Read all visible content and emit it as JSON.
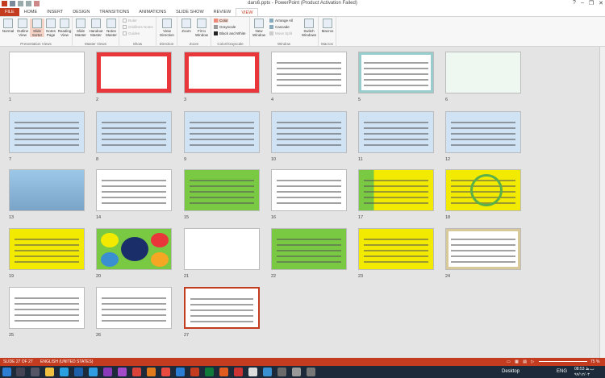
{
  "window": {
    "title": "dars6.pptx - PowerPoint (Product Activation Failed)",
    "controls": [
      "?",
      "–",
      "❐",
      "✕"
    ]
  },
  "tabs": [
    "FILE",
    "HOME",
    "INSERT",
    "DESIGN",
    "TRANSITIONS",
    "ANIMATIONS",
    "SLIDE SHOW",
    "REVIEW",
    "VIEW"
  ],
  "active_tab": "VIEW",
  "ribbon": {
    "presentation_views": {
      "label": "Presentation Views",
      "buttons": [
        "Normal",
        "Outline View",
        "Slide Sorter",
        "Notes Page",
        "Reading View"
      ]
    },
    "master_views": {
      "label": "Master Views",
      "buttons": [
        "Slide Master",
        "Handout Master",
        "Notes Master"
      ]
    },
    "show": {
      "label": "Show",
      "items": [
        "Ruler",
        "Gridlines",
        "Guides"
      ],
      "notes": "Notes"
    },
    "direction": {
      "label": "Direction",
      "view": "View Direction"
    },
    "zoom": {
      "label": "Zoom",
      "buttons": [
        "Zoom",
        "Fit to Window"
      ]
    },
    "color": {
      "label": "Color/Grayscale",
      "items": [
        "Color",
        "Grayscale",
        "Black and White"
      ]
    },
    "window": {
      "label": "Window",
      "new": "New Window",
      "items": [
        "Arrange All",
        "Cascade",
        "Move Split"
      ],
      "switch": "Switch Windows"
    },
    "macros": {
      "label": "Macros",
      "button": "Macros"
    }
  },
  "slides": [
    {
      "n": "1",
      "theme": "cover"
    },
    {
      "n": "2",
      "theme": "roses"
    },
    {
      "n": "3",
      "theme": "roses"
    },
    {
      "n": "4",
      "theme": "figure"
    },
    {
      "n": "5",
      "theme": "frame"
    },
    {
      "n": "6",
      "theme": "flower"
    },
    {
      "n": "7",
      "theme": "text"
    },
    {
      "n": "8",
      "theme": "text"
    },
    {
      "n": "9",
      "theme": "text"
    },
    {
      "n": "10",
      "theme": "text"
    },
    {
      "n": "11",
      "theme": "text"
    },
    {
      "n": "12",
      "theme": "text"
    },
    {
      "n": "13",
      "theme": "photo"
    },
    {
      "n": "14",
      "theme": "bike"
    },
    {
      "n": "15",
      "theme": "green"
    },
    {
      "n": "16",
      "theme": "diagram"
    },
    {
      "n": "17",
      "theme": "greenbox"
    },
    {
      "n": "18",
      "theme": "circle"
    },
    {
      "n": "19",
      "theme": "greenbar"
    },
    {
      "n": "20",
      "theme": "ovals"
    },
    {
      "n": "21",
      "theme": "table"
    },
    {
      "n": "22",
      "theme": "bubble"
    },
    {
      "n": "23",
      "theme": "yellow"
    },
    {
      "n": "24",
      "theme": "scroll"
    },
    {
      "n": "25",
      "theme": "cloud"
    },
    {
      "n": "26",
      "theme": "tablepink"
    },
    {
      "n": "27",
      "theme": "tablepink"
    }
  ],
  "selected_slide": "27",
  "status": {
    "left": "SLIDE 27 OF 27",
    "lang": "ENGLISH (UNITED STATES)",
    "zoom": "75 %"
  },
  "taskbar": {
    "desktop": "Desktop",
    "lang": "ENG",
    "time": "08:53 ب.ظ",
    "date": "٩٩/١٢/٠٣"
  },
  "colors": {
    "accent": "#c33c1f",
    "yellow": "#f2ea00",
    "green": "#7ac943",
    "blue": "#cfe3f5"
  }
}
